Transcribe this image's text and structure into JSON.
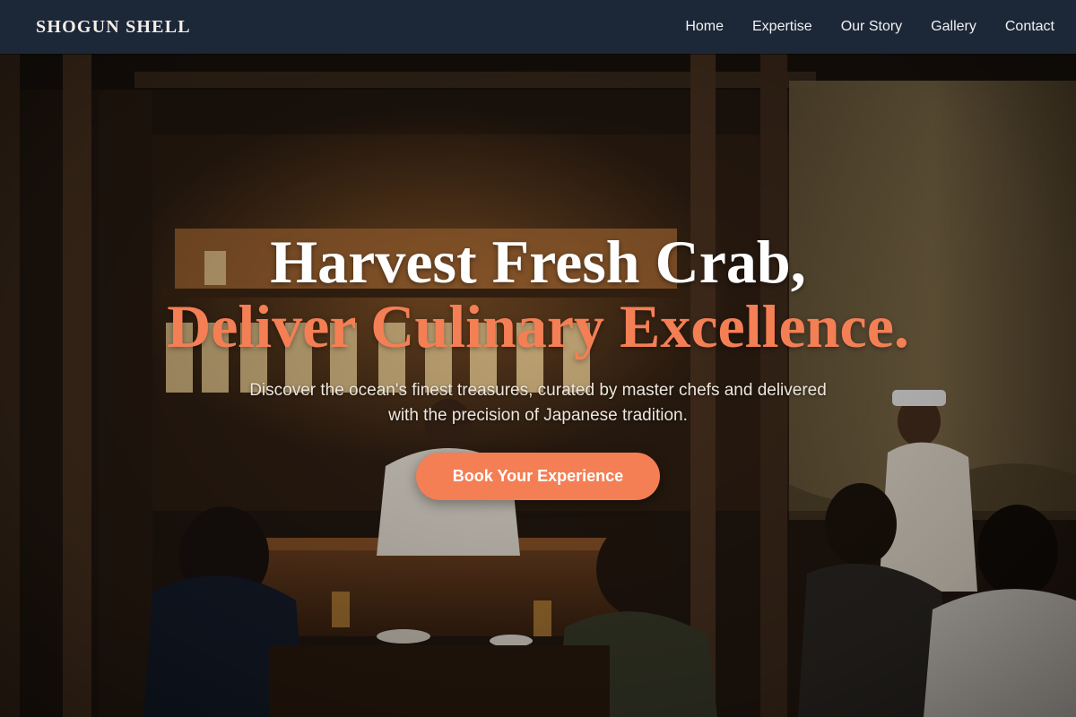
{
  "brand": {
    "name": "SHOGUN SHELL"
  },
  "nav": {
    "links": [
      {
        "label": "Home"
      },
      {
        "label": "Expertise"
      },
      {
        "label": "Our Story"
      },
      {
        "label": "Gallery"
      },
      {
        "label": "Contact"
      }
    ]
  },
  "hero": {
    "headline_line1": "Harvest Fresh Crab,",
    "headline_line2": "Deliver Culinary Excellence.",
    "subtitle": "Discover the ocean's finest treasures, curated by master chefs and delivered with the precision of Japanese tradition.",
    "cta_label": "Book Your Experience",
    "background": "restaurant-interior-photo"
  },
  "colors": {
    "nav_bg": "#1c2738",
    "accent": "#f47f55",
    "headline_white": "#ffffff"
  }
}
